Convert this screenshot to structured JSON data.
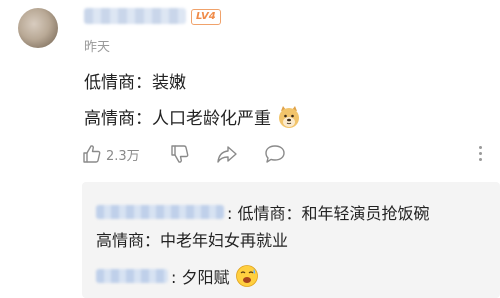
{
  "comment": {
    "time": "昨天",
    "level_badge": "LV4",
    "line1": "低情商：装嫩",
    "line2": "高情商：人口老龄化严重",
    "likes": "2.3万"
  },
  "replies": [
    {
      "text": ": 低情商：和年轻演员抢饭碗"
    },
    {
      "text": "高情商：中老年妇女再就业"
    },
    {
      "text": ": 夕阳赋"
    }
  ],
  "icons": [
    "thumbs-up-icon",
    "thumbs-down-icon",
    "share-icon",
    "comment-icon",
    "more-icon",
    "doge-emoji-icon",
    "sweat-emoji-icon"
  ],
  "colors": {
    "level_badge": "#f08c4a",
    "reply_bg": "#f4f4f4",
    "username_blur": "#c9d6ea"
  }
}
